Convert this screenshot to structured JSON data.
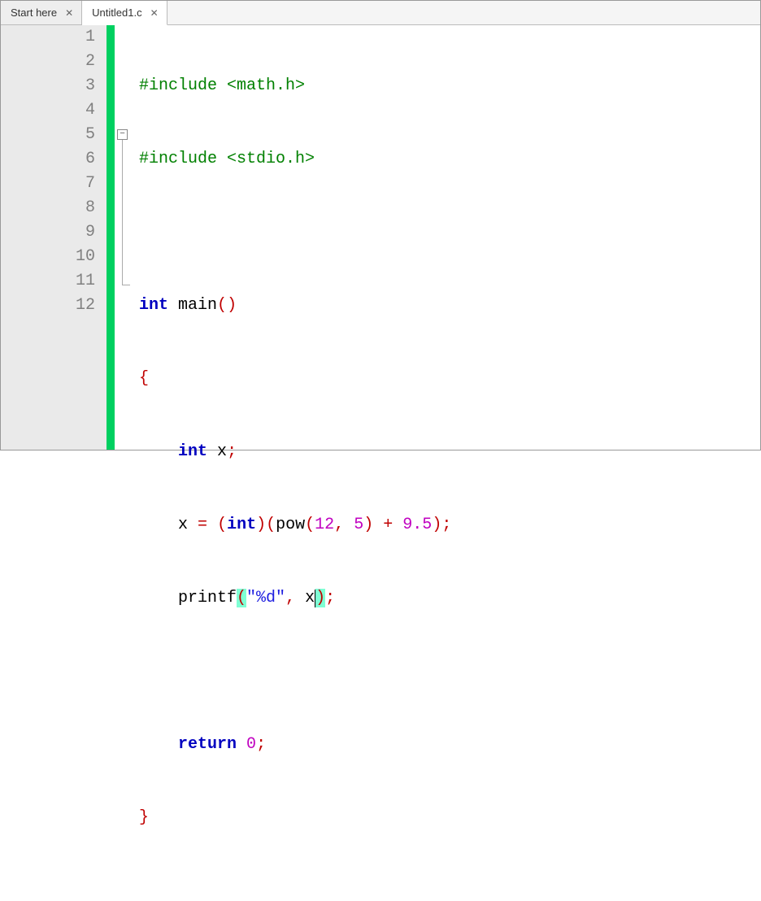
{
  "tabs": [
    {
      "label": "Start here",
      "active": false
    },
    {
      "label": "Untitled1.c",
      "active": true
    }
  ],
  "line_count": 12,
  "preproc": {
    "inc": "#include",
    "h_math": "<math.h>",
    "h_stdio": "<stdio.h>"
  },
  "kw": {
    "int": "int",
    "return": "return"
  },
  "fn": {
    "main": "main",
    "pow": "pow",
    "printf": "printf"
  },
  "id": {
    "x": "x"
  },
  "punct": {
    "lp": "(",
    "rp": ")",
    "lb": "{",
    "rb": "}",
    "semi": ";",
    "comma": ",",
    "eq": "="
  },
  "op": {
    "plus": "+"
  },
  "num": {
    "n12": "12",
    "n5": "5",
    "n95": "9.5",
    "n0": "0"
  },
  "str": {
    "fmt": "\"%d\""
  }
}
